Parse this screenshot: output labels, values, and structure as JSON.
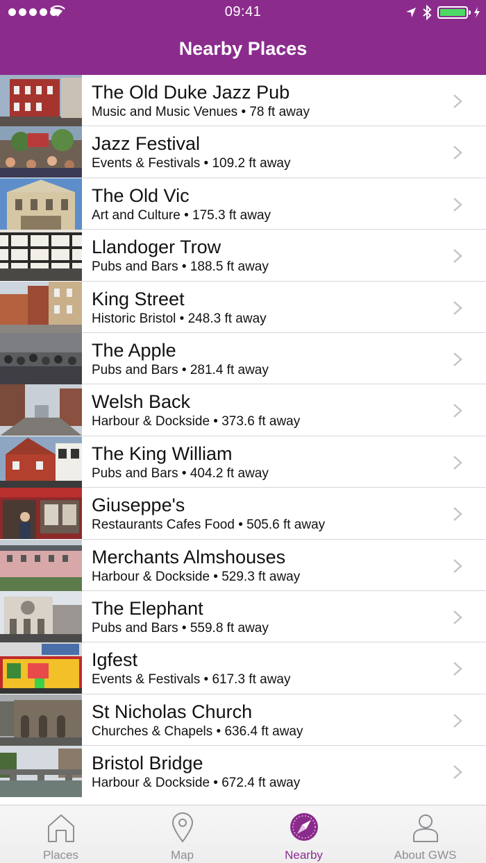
{
  "status_bar": {
    "time": "09:41"
  },
  "nav": {
    "title": "Nearby Places"
  },
  "places": [
    {
      "name": "The Old Duke Jazz Pub",
      "subtitle": "Music and Music Venues • 78 ft away"
    },
    {
      "name": "Jazz Festival",
      "subtitle": "Events & Festivals • 109.2 ft away"
    },
    {
      "name": "The Old Vic",
      "subtitle": "Art and Culture • 175.3 ft away"
    },
    {
      "name": "Llandoger Trow",
      "subtitle": "Pubs and Bars • 188.5 ft away"
    },
    {
      "name": "King Street",
      "subtitle": "Historic Bristol • 248.3 ft away"
    },
    {
      "name": "The Apple",
      "subtitle": "Pubs and Bars • 281.4 ft away"
    },
    {
      "name": "Welsh Back",
      "subtitle": "Harbour & Dockside • 373.6 ft away"
    },
    {
      "name": "The King William",
      "subtitle": "Pubs and Bars • 404.2 ft away"
    },
    {
      "name": "Giuseppe's",
      "subtitle": "Restaurants Cafes Food • 505.6 ft away"
    },
    {
      "name": "Merchants Almshouses",
      "subtitle": "Harbour & Dockside • 529.3 ft away"
    },
    {
      "name": "The Elephant",
      "subtitle": "Pubs and Bars • 559.8 ft away"
    },
    {
      "name": "Igfest",
      "subtitle": "Events & Festivals • 617.3 ft away"
    },
    {
      "name": "St Nicholas Church",
      "subtitle": "Churches & Chapels • 636.4 ft away"
    },
    {
      "name": "Bristol Bridge",
      "subtitle": "Harbour & Dockside • 672.4 ft away"
    }
  ],
  "tabs": [
    {
      "label": "Places",
      "icon": "house-icon",
      "active": false
    },
    {
      "label": "Map",
      "icon": "map-pin-icon",
      "active": false
    },
    {
      "label": "Nearby",
      "icon": "compass-icon",
      "active": true
    },
    {
      "label": "About GWS",
      "icon": "person-icon",
      "active": false
    }
  ],
  "colors": {
    "brand": "#8b2c8d",
    "battery": "#4cd964",
    "inactive_tab": "#8e8e93"
  }
}
